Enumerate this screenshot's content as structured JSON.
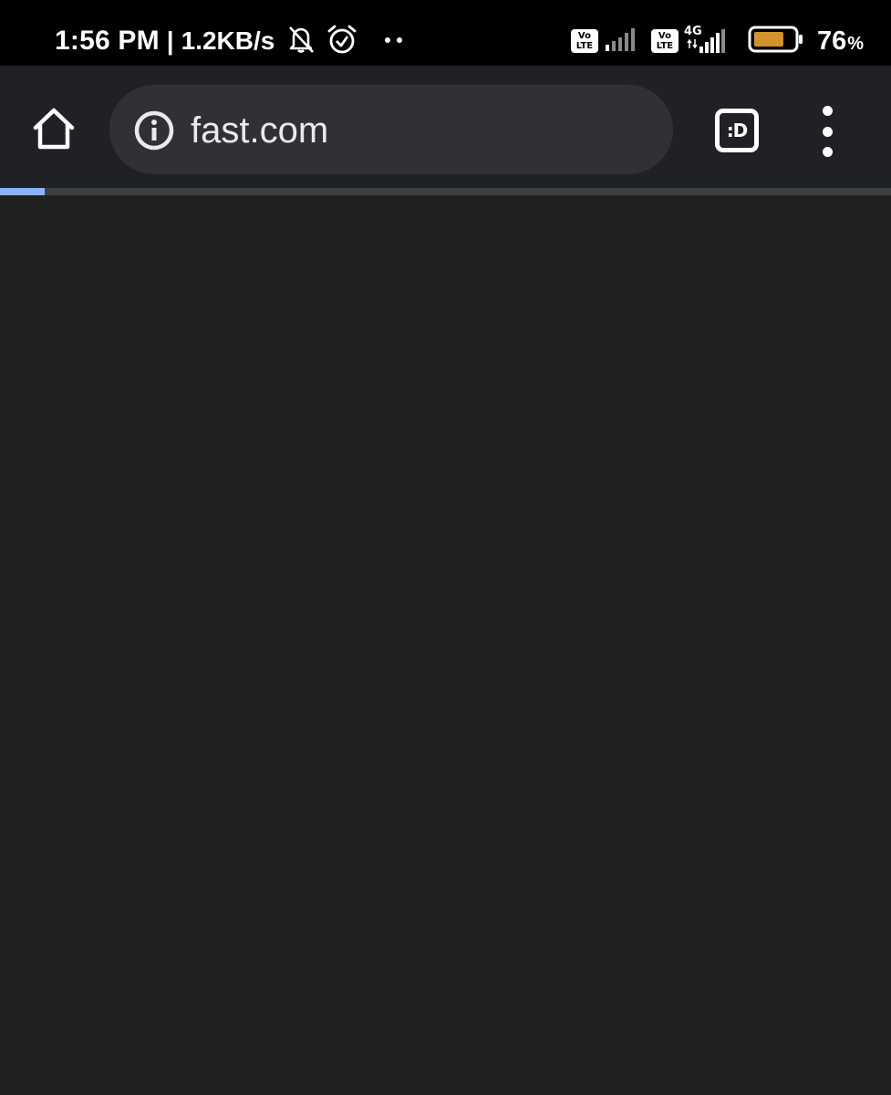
{
  "status_bar": {
    "time": "1:56 PM",
    "separator": "|",
    "network_speed": "1.2KB/s",
    "notification_icons": [
      "bell-off-icon",
      "alarm-icon",
      "more-dots-icon"
    ],
    "sim1": {
      "volte_top": "Vo",
      "volte_bottom": "LTE",
      "signal_icon": "signal-bars-icon"
    },
    "sim2": {
      "volte_top": "Vo",
      "volte_bottom": "LTE",
      "network_type": "4G",
      "signal_icon": "signal-bars-icon"
    },
    "battery_level": 76,
    "battery_value": "76",
    "battery_unit": "%",
    "battery_color": "#d4932a"
  },
  "toolbar": {
    "home_icon": "home-icon",
    "site_info_icon": "info-icon",
    "url": "fast.com",
    "tab_switcher_label": ":D",
    "menu_icon": "more-vert-icon"
  },
  "page_load": {
    "progress_fraction": 0.05,
    "progress_color": "#8ab4f8"
  },
  "colors": {
    "status_bar_bg": "#000000",
    "toolbar_bg": "#202124",
    "omnibox_bg": "#303134",
    "content_bg": "#202020"
  }
}
